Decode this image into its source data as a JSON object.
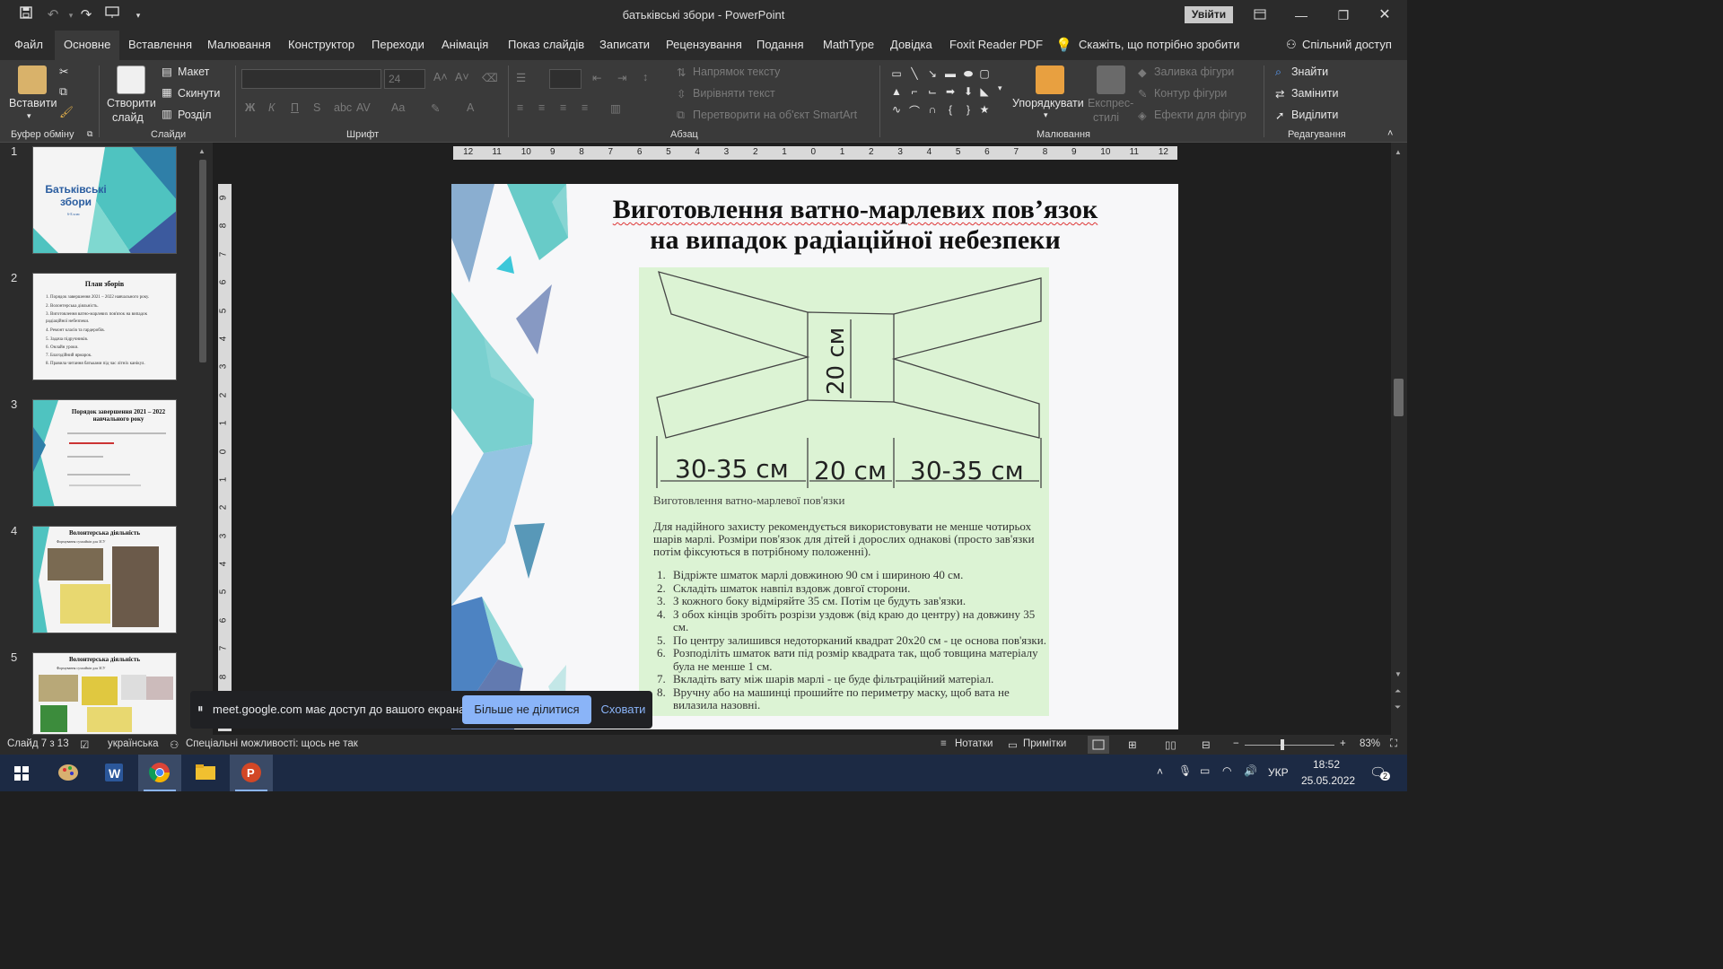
{
  "window": {
    "title": "батьківські збори  -  PowerPoint",
    "signin": "Увійти"
  },
  "tabs": [
    "Файл",
    "Основне",
    "Вставлення",
    "Малювання",
    "Конструктор",
    "Переходи",
    "Анімація",
    "Показ слайдів",
    "Записати",
    "Рецензування",
    "Подання",
    "MathType",
    "Довідка",
    "Foxit Reader PDF"
  ],
  "tellme": "Скажіть, що потрібно зробити",
  "share": "Спільний доступ",
  "ribbon": {
    "paste": "Вставити",
    "new_slide_1": "Створити",
    "new_slide_2": "слайд",
    "layout": "Макет",
    "reset": "Скинути",
    "section": "Розділ",
    "font_size": "24",
    "text_direction": "Напрямок тексту",
    "align_text": "Вирівняти текст",
    "smartart": "Перетворити на об'єкт SmartArt",
    "arrange": "Упорядкувати",
    "quick_styles_1": "Експрес-",
    "quick_styles_2": "стилі",
    "shape_fill": "Заливка фігури",
    "shape_outline": "Контур фігури",
    "shape_effects": "Ефекти для фігур",
    "find": "Знайти",
    "replace": "Замінити",
    "select": "Виділити",
    "groups": {
      "clipboard": "Буфер обміну",
      "slides": "Слайди",
      "font": "Шрифт",
      "paragraph": "Абзац",
      "drawing": "Малювання",
      "editing": "Редагування"
    }
  },
  "thumbnails": [
    {
      "num": "1",
      "title": "Батьківські збори",
      "sub": "6-Б клас"
    },
    {
      "num": "2",
      "title": "План зборів",
      "lines": [
        "1.  Порядок завершення 2021 – 2022 навчального року.",
        "2.  Волонтерська діяльність.",
        "3.  Виготовлення ватно-марлевих пов'язок на випадок",
        "     радіаційної небезпеки.",
        "4.  Ремонт класів та гардеробів.",
        "5.  Задача підручників.",
        "6.  Онлайн уроки.",
        "7.  Благодійний ярмарок.",
        "8.  Правила читання батьками під час літніх канікул."
      ]
    },
    {
      "num": "3",
      "title": "Порядок завершення 2021 – 2022 навчального року"
    },
    {
      "num": "4",
      "title": "Волонтерська діяльність",
      "sub": "Формування сухпайків для ЗСУ"
    },
    {
      "num": "5",
      "title": "Волонтерська діяльність",
      "sub": "Формування сухпайків для ЗСУ"
    }
  ],
  "slide": {
    "title_line1": "Виготовлення ватно-марлевих пов’язок",
    "title_line2": "на випадок радіаційної небезпеки",
    "dim_center_vertical": "20 см",
    "dim_left": "30-35 см",
    "dim_center": "20 см",
    "dim_right": "30-35 см",
    "caption": "Виготовлення ватно-марлевої пов'язки",
    "paragraph": "Для надійного захисту рекомендується використовувати не менше чотирьох шарів марлі. Розміри пов'язок для дітей і дорослих однакові (просто зав'язки потім фіксуються в потрібному положенні).",
    "steps": [
      "Відріжте шматок марлі довжиною 90 см і шириною 40 см.",
      "Складіть шматок навпіл вздовж довгої сторони.",
      "З кожного боку відміряйте 35 см. Потім це будуть зав'язки.",
      "З обох кінців зробіть розрізи уздовж (від краю до центру) на довжину 35 см.",
      "По центру залишився недоторканий квадрат 20х20 см - це основа пов'язки.",
      "Розподіліть шматок вати під розмір квадрата так, щоб товщина матеріалу була не менше 1 см.",
      "Вкладіть вату між шарів марлі - це буде фільтраційний матеріал.",
      "Вручну або на машинці прошийте по периметру маску, щоб вата не вилазила назовні."
    ]
  },
  "sharebar": {
    "text": "meet.google.com має доступ до вашого екрана.",
    "stop": "Більше не ділитися",
    "hide": "Сховати"
  },
  "status": {
    "slide": "Слайд 7 з 13",
    "lang": "українська",
    "accessibility": "Спеціальні можливості: щось не так",
    "notes": "Нотатки",
    "comments": "Примітки",
    "zoom": "83%"
  },
  "taskbar": {
    "lang": "УКР",
    "time": "18:52",
    "date": "25.05.2022",
    "notif": "2"
  },
  "hruler_ticks": [
    "12",
    "11",
    "10",
    "9",
    "8",
    "7",
    "6",
    "5",
    "4",
    "3",
    "2",
    "1",
    "0",
    "1",
    "2",
    "3",
    "4",
    "5",
    "6",
    "7",
    "8",
    "9",
    "10",
    "11",
    "12"
  ],
  "vruler_ticks": [
    "9",
    "8",
    "7",
    "6",
    "5",
    "4",
    "3",
    "2",
    "1",
    "0",
    "1",
    "2",
    "3",
    "4",
    "5",
    "6",
    "7",
    "8"
  ]
}
